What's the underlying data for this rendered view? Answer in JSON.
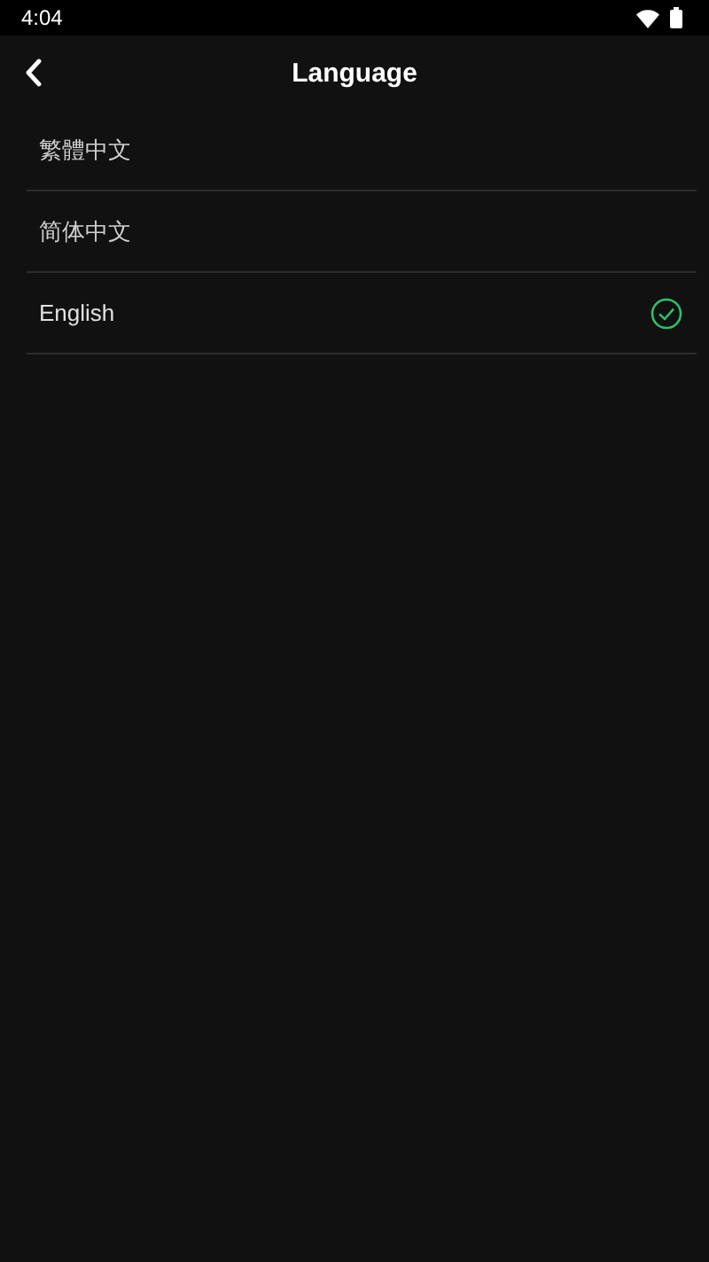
{
  "status_bar": {
    "time": "4:04"
  },
  "header": {
    "title": "Language"
  },
  "languages": [
    {
      "label": "繁體中文",
      "selected": false
    },
    {
      "label": "简体中文",
      "selected": false
    },
    {
      "label": "English",
      "selected": true
    }
  ]
}
